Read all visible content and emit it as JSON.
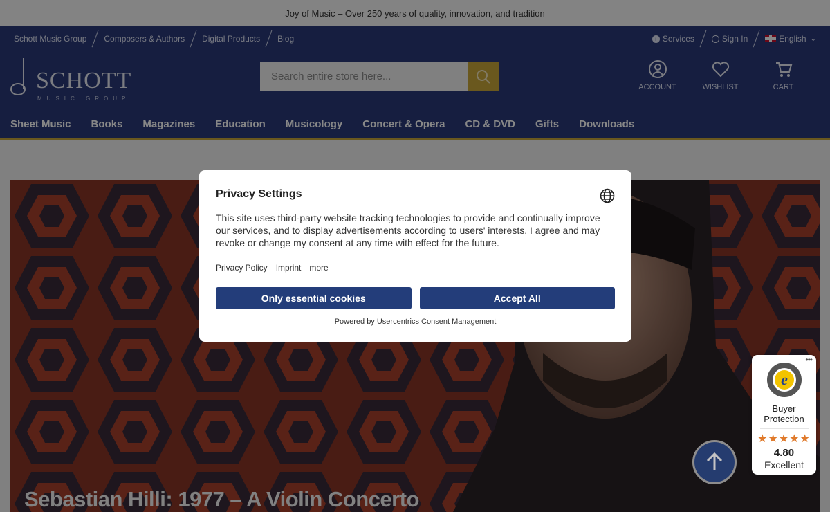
{
  "promo": {
    "text": "Joy of Music – Over 250 years of quality, innovation, and tradition"
  },
  "utility": {
    "links": [
      "Schott Music Group",
      "Composers & Authors",
      "Digital Products",
      "Blog"
    ],
    "services": "Services",
    "signin": "Sign In",
    "language": "English"
  },
  "logo": {
    "brand": "SCHOTT",
    "tagline": "MUSIC GROUP"
  },
  "search": {
    "placeholder": "Search entire store here..."
  },
  "icons": {
    "account": "ACCOUNT",
    "wishlist": "WISHLIST",
    "cart": "CART"
  },
  "nav": [
    "Sheet Music",
    "Books",
    "Magazines",
    "Education",
    "Musicology",
    "Concert & Opera",
    "CD & DVD",
    "Gifts",
    "Downloads"
  ],
  "hero": {
    "title": "Sebastian Hilli: 1977 – A Violin Concerto"
  },
  "modal": {
    "title": "Privacy Settings",
    "body": "This site uses third-party website tracking technologies to provide and continually improve our services, and to display advertisements according to users' interests. I agree and may revoke or change my consent at any time with effect for the future.",
    "links": [
      "Privacy Policy",
      "Imprint",
      "more"
    ],
    "essential_button": "Only essential cookies",
    "accept_button": "Accept All",
    "powered": "Powered by Usercentrics Consent Management"
  },
  "trust": {
    "more": "•••",
    "label_line1": "Buyer",
    "label_line2": "Protection",
    "stars": "★★★★★",
    "score": "4.80",
    "rating": "Excellent"
  },
  "colors": {
    "header": "#2a3a7a",
    "accent": "#c9a73a",
    "button": "#233d7a",
    "stars": "#e07a2b"
  }
}
